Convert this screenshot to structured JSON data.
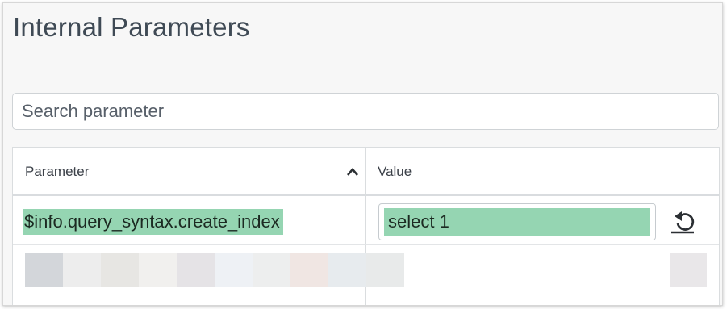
{
  "page": {
    "title": "Internal Parameters"
  },
  "search": {
    "placeholder": "Search parameter",
    "value": ""
  },
  "table": {
    "columns": {
      "parameter": "Parameter",
      "value": "Value"
    },
    "sort": "ascending",
    "rows": [
      {
        "parameter": "$info.query_syntax.create_index",
        "value": "select 1",
        "highlighted": true
      }
    ]
  },
  "icons": {
    "sort": "chevron-up-icon",
    "reset": "reset-icon"
  },
  "colors": {
    "highlight": "#95d5b2",
    "text": "#3f4a55"
  },
  "redacted_row_swatches": [
    "#d3d6da",
    "#ededed",
    "#e7e6e3",
    "#f1f0ee",
    "#e5e3e6",
    "#eef1f5",
    "#edeeee",
    "#f0e6e3",
    "#e7ebee",
    "#e8eaea"
  ],
  "redacted_row_end_swatch": "#e9e7e9"
}
